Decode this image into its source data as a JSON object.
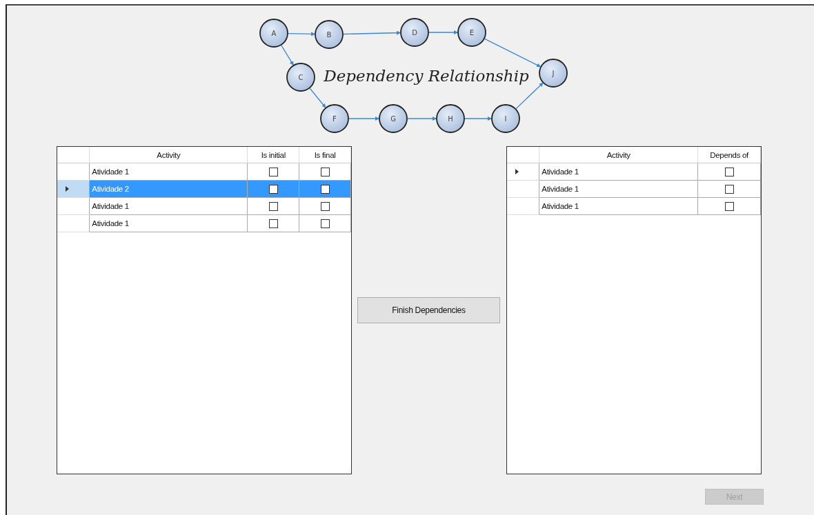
{
  "diagram": {
    "title": "Dependency Relationship",
    "nodes": [
      {
        "label": "A"
      },
      {
        "label": "B"
      },
      {
        "label": "D"
      },
      {
        "label": "E"
      },
      {
        "label": "J"
      },
      {
        "label": "C"
      },
      {
        "label": "F"
      },
      {
        "label": "G"
      },
      {
        "label": "H"
      },
      {
        "label": "I"
      }
    ]
  },
  "left_grid": {
    "columns": [
      {
        "header": "Activity",
        "kind": "text"
      },
      {
        "header": "Is initial",
        "kind": "check"
      },
      {
        "header": "Is final",
        "kind": "check"
      }
    ],
    "rows": [
      {
        "selected": false,
        "current": false,
        "cells": [
          {
            "text": "Atividade 1"
          },
          {
            "checked": false
          },
          {
            "checked": false
          }
        ]
      },
      {
        "selected": true,
        "current": true,
        "cells": [
          {
            "text": "Atividade 2"
          },
          {
            "checked": false
          },
          {
            "checked": false
          }
        ]
      },
      {
        "selected": false,
        "current": false,
        "cells": [
          {
            "text": "Atividade 1"
          },
          {
            "checked": false
          },
          {
            "checked": false
          }
        ]
      },
      {
        "selected": false,
        "current": false,
        "cells": [
          {
            "text": "Atividade 1"
          },
          {
            "checked": false
          },
          {
            "checked": false
          }
        ]
      }
    ]
  },
  "finish_button": {
    "label": "Finish Dependencies"
  },
  "right_grid": {
    "columns": [
      {
        "header": "Activity",
        "kind": "text"
      },
      {
        "header": "Depends of",
        "kind": "check"
      }
    ],
    "rows": [
      {
        "selected": false,
        "current": true,
        "cells": [
          {
            "text": "Atividade 1"
          },
          {
            "checked": false
          }
        ]
      },
      {
        "selected": false,
        "current": false,
        "cells": [
          {
            "text": "Atividade 1"
          },
          {
            "checked": false
          }
        ]
      },
      {
        "selected": false,
        "current": false,
        "cells": [
          {
            "text": "Atividade 1"
          },
          {
            "checked": false
          }
        ]
      }
    ]
  },
  "next_button": {
    "label": "Next",
    "disabled": true
  }
}
